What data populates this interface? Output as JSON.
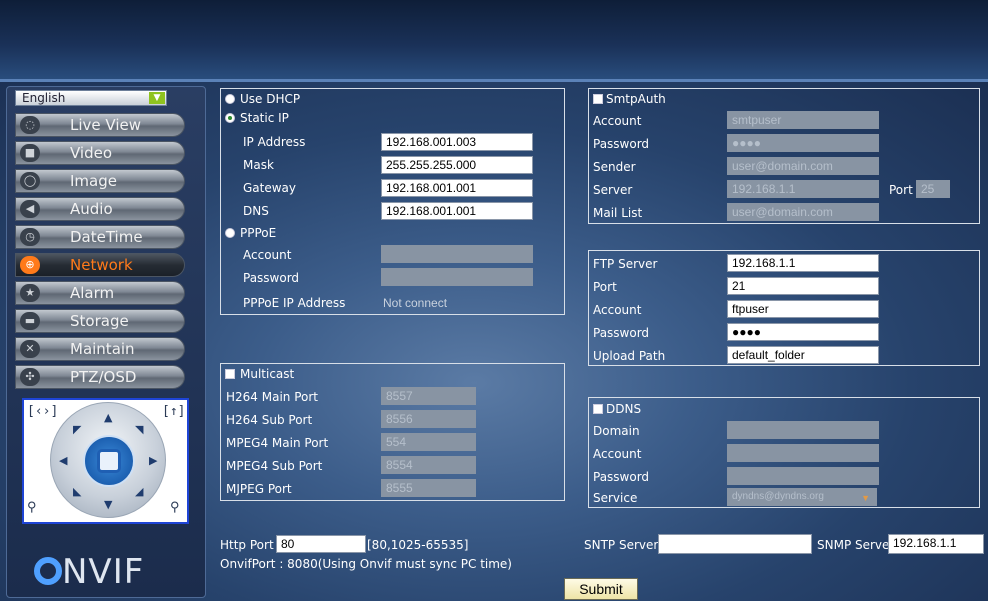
{
  "sidebar": {
    "language": "English",
    "menu": [
      {
        "label": "Live View",
        "icon": "speech-bubble-icon",
        "active": false
      },
      {
        "label": "Video",
        "icon": "camera-icon",
        "active": false
      },
      {
        "label": "Image",
        "icon": "power-icon",
        "active": false
      },
      {
        "label": "Audio",
        "icon": "speaker-icon",
        "active": false
      },
      {
        "label": "DateTime",
        "icon": "clock-icon",
        "active": false
      },
      {
        "label": "Network",
        "icon": "globe-icon",
        "active": true
      },
      {
        "label": "Alarm",
        "icon": "star-icon",
        "active": false
      },
      {
        "label": "Storage",
        "icon": "drive-icon",
        "active": false
      },
      {
        "label": "Maintain",
        "icon": "tools-icon",
        "active": false
      },
      {
        "label": "PTZ/OSD",
        "icon": "move-icon",
        "active": false
      }
    ],
    "ptz": {
      "zoom_out": "[‹›]",
      "zoom_in": "[↑]"
    },
    "logo": "ONVIF"
  },
  "ip": {
    "dhcp_label": "Use DHCP",
    "static_label": "Static IP",
    "static_selected": true,
    "ip_address_label": "IP Address",
    "ip_address": "192.168.001.003",
    "mask_label": "Mask",
    "mask": "255.255.255.000",
    "gateway_label": "Gateway",
    "gateway": "192.168.001.001",
    "dns_label": "DNS",
    "dns": "192.168.001.001",
    "pppoe_label": "PPPoE",
    "pppoe_account_label": "Account",
    "pppoe_account": "",
    "pppoe_password_label": "Password",
    "pppoe_password": "",
    "pppoe_ip_label": "PPPoE IP Address",
    "pppoe_ip_status": "Not connect"
  },
  "multicast": {
    "label": "Multicast",
    "h264_main_label": "H264 Main Port",
    "h264_main": "8557",
    "h264_sub_label": "H264 Sub Port",
    "h264_sub": "8556",
    "mpeg4_main_label": "MPEG4 Main Port",
    "mpeg4_main": "554",
    "mpeg4_sub_label": "MPEG4 Sub Port",
    "mpeg4_sub": "8554",
    "mjpeg_label": "MJPEG Port",
    "mjpeg": "8555"
  },
  "http": {
    "port_label": "Http Port",
    "port": "80",
    "range": "[80,1025-65535]",
    "onvif_note": "OnvifPort : 8080(Using Onvif must sync PC time)"
  },
  "smtp": {
    "label": "SmtpAuth",
    "account_label": "Account",
    "account": "smtpuser",
    "password_label": "Password",
    "password": "●●●●",
    "sender_label": "Sender",
    "sender": "user@domain.com",
    "server_label": "Server",
    "server": "192.168.1.1",
    "port_label": "Port",
    "port": "25",
    "mail_list_label": "Mail List",
    "mail_list": "user@domain.com"
  },
  "ftp": {
    "server_label": "FTP Server",
    "server": "192.168.1.1",
    "port_label": "Port",
    "port": "21",
    "account_label": "Account",
    "account": "ftpuser",
    "password_label": "Password",
    "password": "●●●●",
    "upload_label": "Upload Path",
    "upload": "default_folder"
  },
  "ddns": {
    "label": "DDNS",
    "domain_label": "Domain",
    "domain": "",
    "account_label": "Account",
    "account": "",
    "password_label": "Password",
    "password": "",
    "service_label": "Service",
    "service": "dyndns@dyndns.org"
  },
  "sntp": {
    "label": "SNTP Server",
    "value": ""
  },
  "snmp": {
    "label": "SNMP Server",
    "value": "192.168.1.1"
  },
  "submit_label": "Submit"
}
